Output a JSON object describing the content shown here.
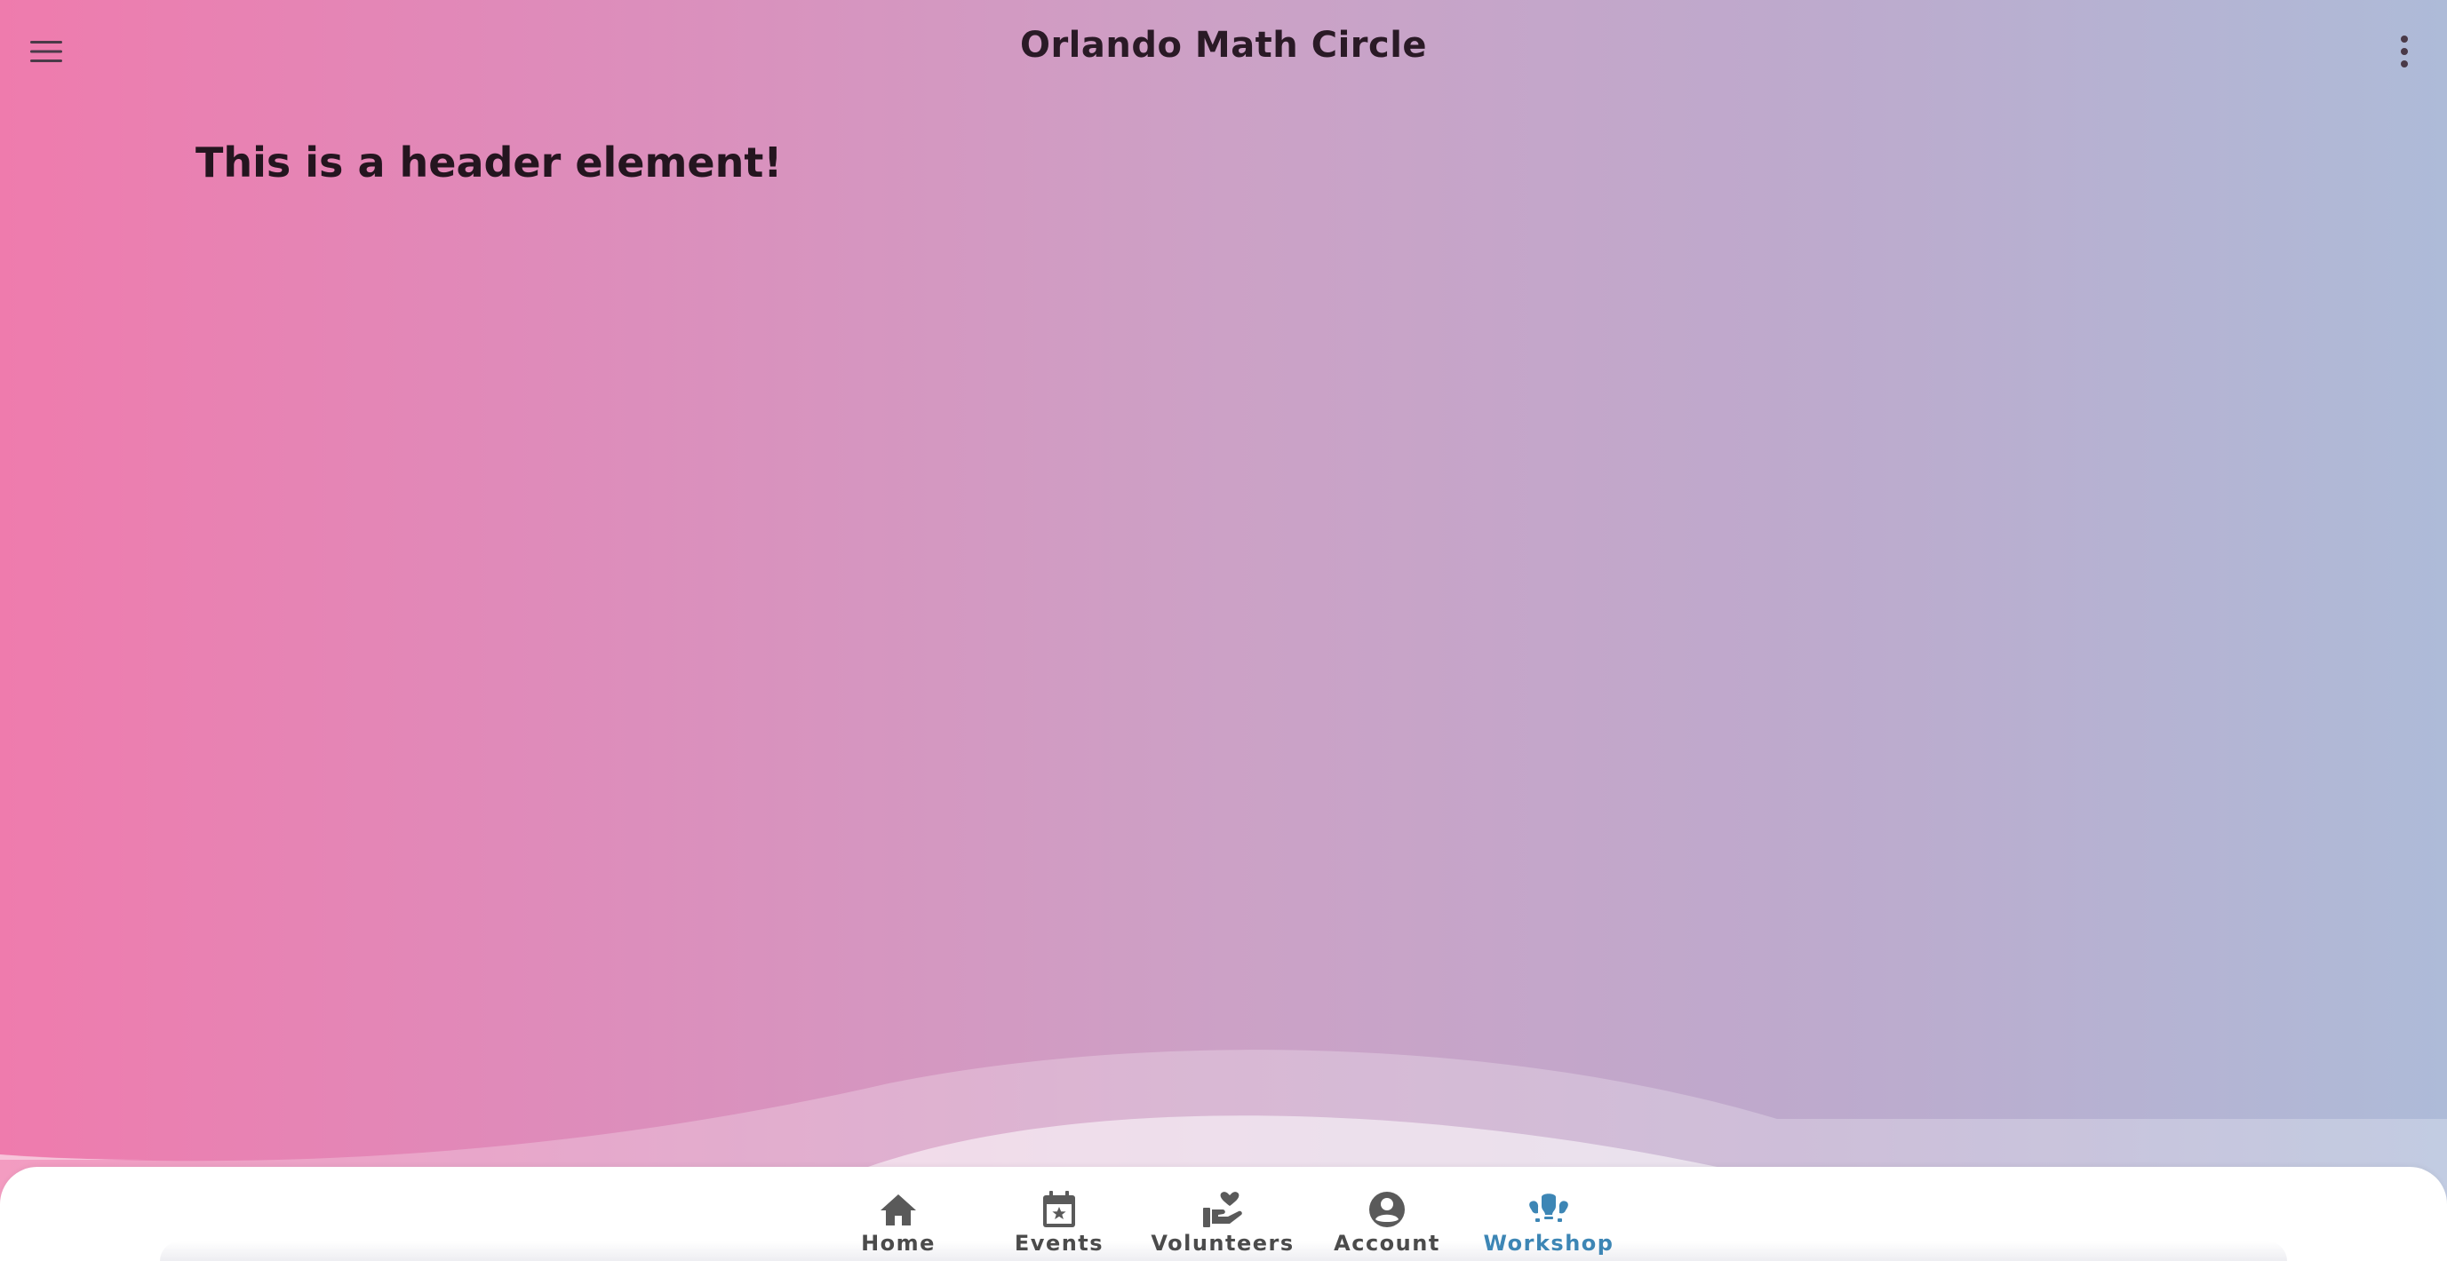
{
  "appbar": {
    "title": "Orlando Math Circle",
    "menu_icon": "hamburger-menu-icon",
    "more_icon": "more-vertical-icon"
  },
  "main": {
    "header": "This is a header element!"
  },
  "bottom_nav": {
    "active_color": "#3d86b5",
    "inactive_color": "#4b4b4b",
    "items": [
      {
        "label": "Home",
        "icon": "home-icon",
        "active": false
      },
      {
        "label": "Events",
        "icon": "calendar-star-icon",
        "active": false
      },
      {
        "label": "Volunteers",
        "icon": "volunteer-hand-heart-icon",
        "active": false
      },
      {
        "label": "Account",
        "icon": "account-circle-icon",
        "active": false
      },
      {
        "label": "Workshop",
        "icon": "workshop-icon",
        "active": true
      }
    ]
  }
}
